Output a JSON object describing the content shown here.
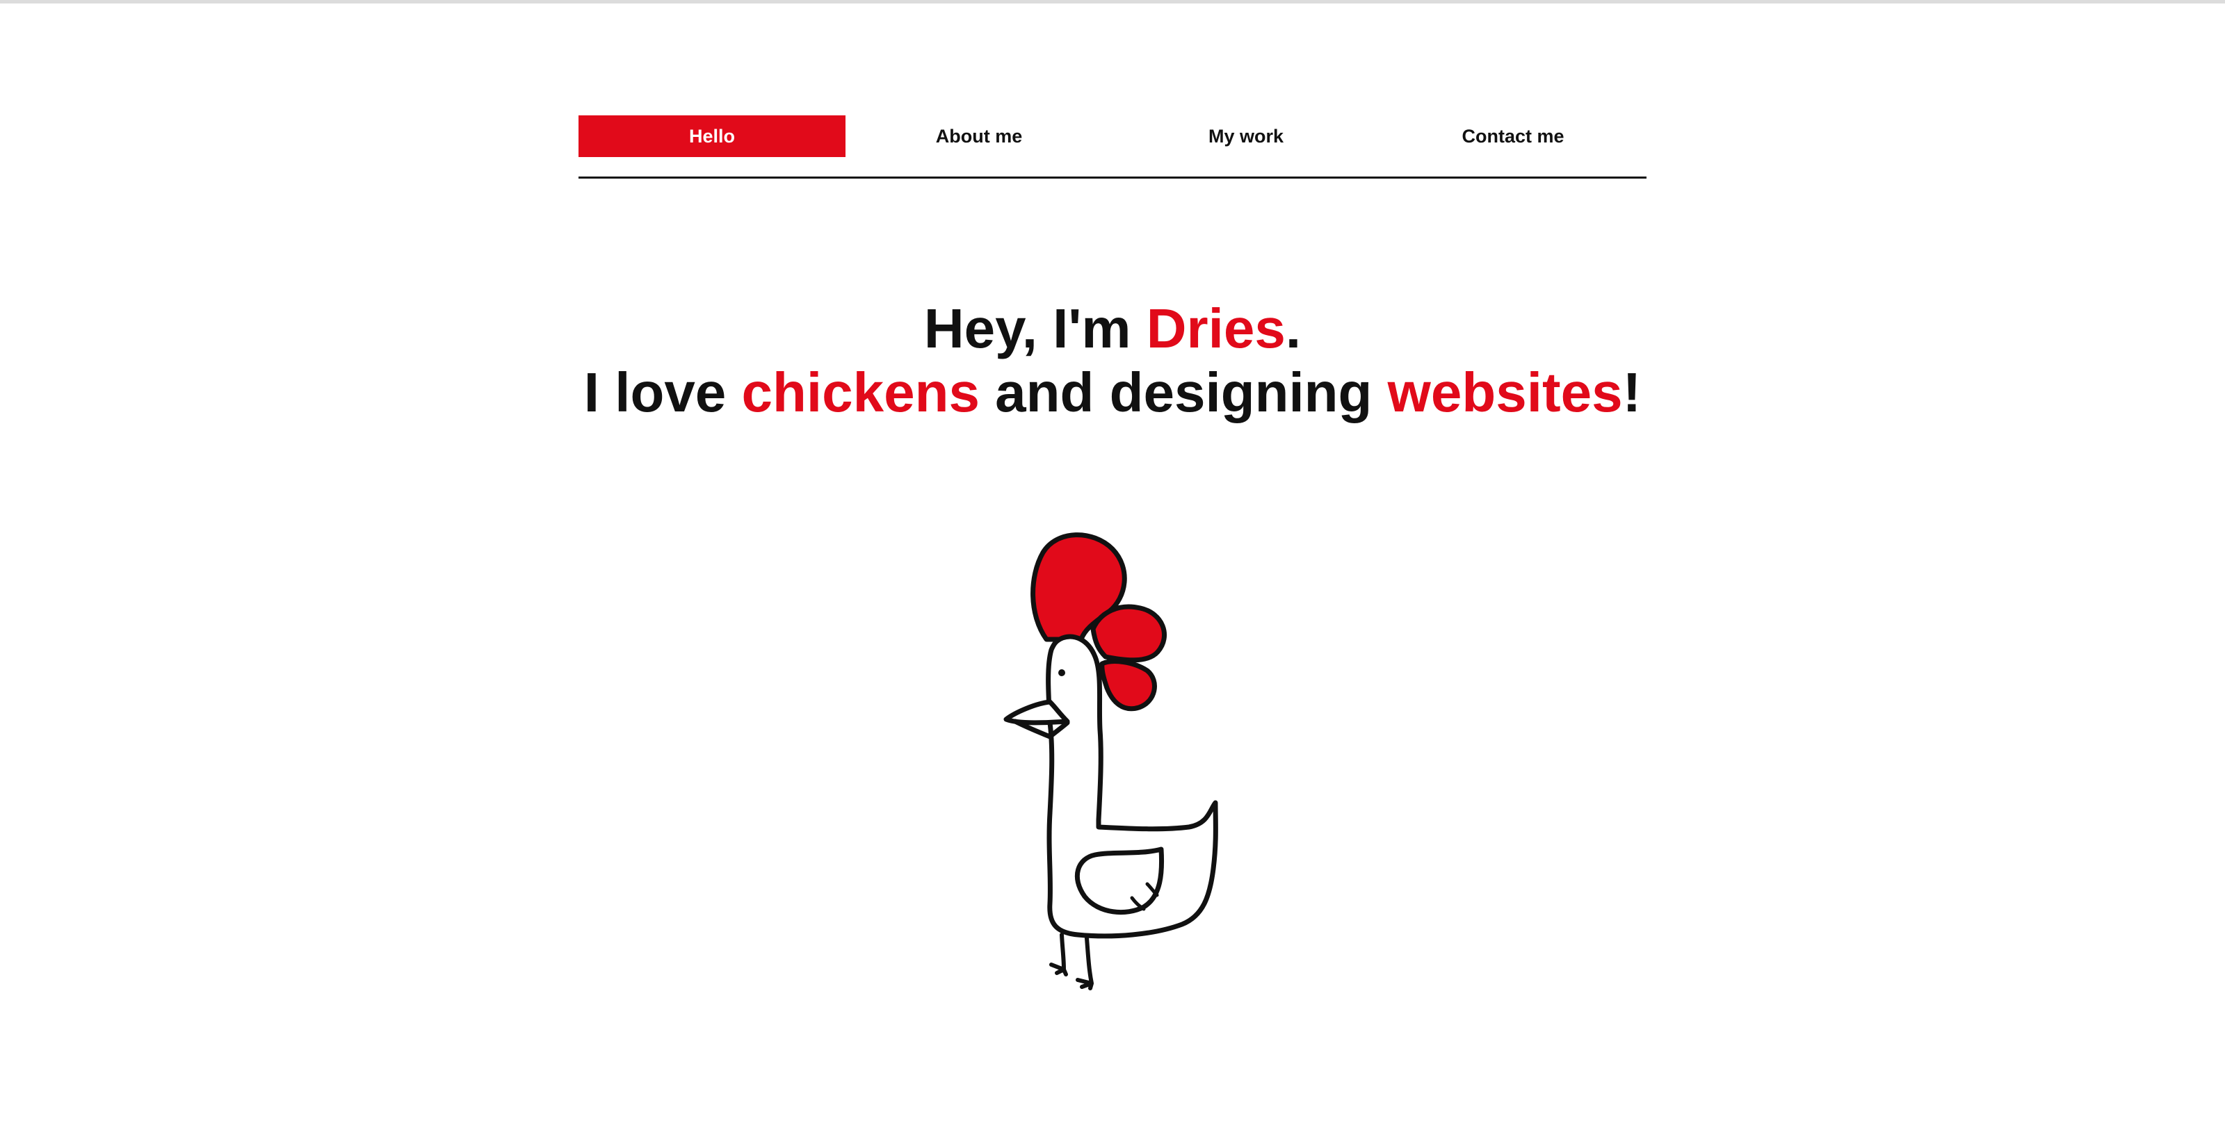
{
  "nav": {
    "items": [
      {
        "label": "Hello",
        "active": true
      },
      {
        "label": "About me",
        "active": false
      },
      {
        "label": "My work",
        "active": false
      },
      {
        "label": "Contact me",
        "active": false
      }
    ]
  },
  "hero": {
    "line1": {
      "prefix": "Hey, I'm ",
      "name": "Dries",
      "suffix": "."
    },
    "line2": {
      "prefix": "I love ",
      "word1": "chickens",
      "middle": " and designing ",
      "word2": "websites",
      "suffix": "!"
    }
  },
  "illustration": {
    "icon": "rooster-illustration"
  },
  "colors": {
    "accent": "#e10a1a",
    "text": "#111111",
    "background": "#ffffff"
  }
}
